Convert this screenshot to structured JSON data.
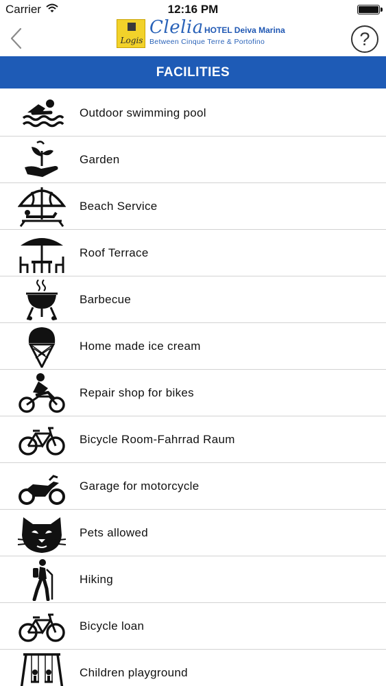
{
  "status": {
    "carrier": "Carrier",
    "time": "12:16 PM"
  },
  "nav": {
    "back_icon": "chevron-left-icon",
    "logo": {
      "badge_text": "Logis",
      "script_name": "Clelia",
      "hotel_name": "HOTEL Deiva Marina",
      "tagline": "Between Cinque Terre & Portofino"
    },
    "help_label": "?"
  },
  "header": {
    "title": "FACILITIES"
  },
  "colors": {
    "header_bg": "#1e5bb6",
    "brand_blue": "#2962b8",
    "logo_yellow": "#f2d22a"
  },
  "facilities": [
    {
      "label": "Outdoor swimming pool",
      "icon": "swimmer-icon"
    },
    {
      "label": "Garden",
      "icon": "plant-hand-icon"
    },
    {
      "label": "Beach Service",
      "icon": "beach-umbrella-icon"
    },
    {
      "label": "Roof Terrace",
      "icon": "terrace-table-icon"
    },
    {
      "label": "Barbecue",
      "icon": "barbecue-grill-icon"
    },
    {
      "label": "Home made ice cream",
      "icon": "ice-cream-cone-icon"
    },
    {
      "label": "Repair shop for bikes",
      "icon": "motocross-rider-icon"
    },
    {
      "label": "Bicycle Room-Fahrrad Raum",
      "icon": "bicycle-icon"
    },
    {
      "label": "Garage for motorcycle",
      "icon": "motorcycle-icon"
    },
    {
      "label": "Pets allowed",
      "icon": "cat-face-icon"
    },
    {
      "label": "Hiking",
      "icon": "hiker-icon"
    },
    {
      "label": "Bicycle loan",
      "icon": "bicycle-icon"
    },
    {
      "label": "Children playground",
      "icon": "swing-set-icon"
    }
  ]
}
